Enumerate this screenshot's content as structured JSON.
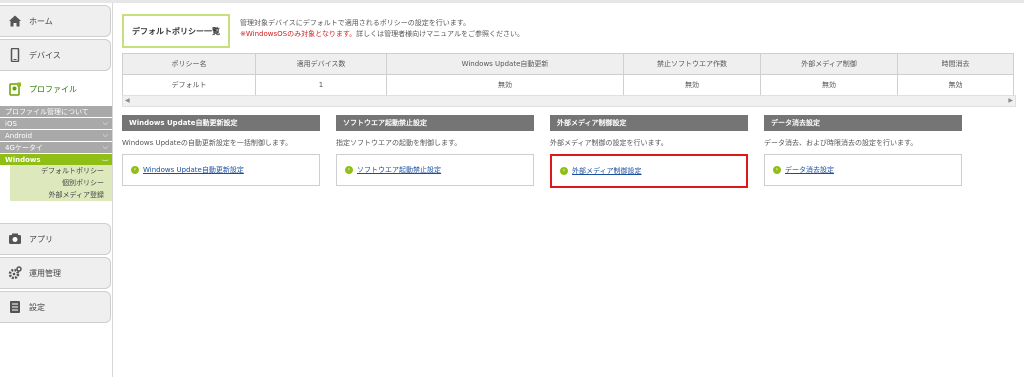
{
  "sidebar": {
    "items": [
      {
        "label": "ホーム",
        "icon": "home-icon"
      },
      {
        "label": "デバイス",
        "icon": "smartphone-icon"
      },
      {
        "label": "プロファイル",
        "icon": "profile-icon"
      },
      {
        "label": "アプリ",
        "icon": "app-icon"
      },
      {
        "label": "運用管理",
        "icon": "gear-icon"
      },
      {
        "label": "設定",
        "icon": "settings-list-icon"
      }
    ],
    "profile_sub": {
      "about": "プロファイル管理について",
      "ios": "iOS",
      "android": "Android",
      "keitai": "4Gケータイ",
      "windows": "Windows",
      "windows_items": [
        "デフォルトポリシー",
        "個別ポリシー",
        "外部メディア登録"
      ]
    }
  },
  "header": {
    "title": "デフォルトポリシー一覧",
    "desc_line1": "管理対象デバイスにデフォルトで適用されるポリシーの設定を行います。",
    "desc_warn": "※WindowsOSのみ対象となります。",
    "desc_line2_rest": "詳しくは管理者様向けマニュアルをご参照ください。"
  },
  "table": {
    "columns": [
      "ポリシー名",
      "適用デバイス数",
      "Windows Update自動更新",
      "禁止ソフトウエア作数",
      "外部メディア制御",
      "時間消去"
    ],
    "rows": [
      [
        "デフォルト",
        "1",
        "無効",
        "無効",
        "無効",
        "無効"
      ]
    ]
  },
  "cards": [
    {
      "title": "Windows Update自動更新設定",
      "desc": "Windows Updateの自動更新設定を一括制御します。",
      "link": "Windows Update自動更新設定"
    },
    {
      "title": "ソフトウエア起動禁止設定",
      "desc": "指定ソフトウエアの起動を制御します。",
      "link": "ソフトウエア起動禁止設定"
    },
    {
      "title": "外部メディア制御設定",
      "desc": "外部メディア制御の設定を行います。",
      "link": "外部メディア制御設定"
    },
    {
      "title": "データ消去設定",
      "desc": "データ消去、および時限消去の設定を行います。",
      "link": "データ消去設定"
    }
  ],
  "colors": {
    "accent_green": "#8fbf15",
    "highlight_red": "#e01818",
    "link_blue": "#1a4fa0"
  }
}
